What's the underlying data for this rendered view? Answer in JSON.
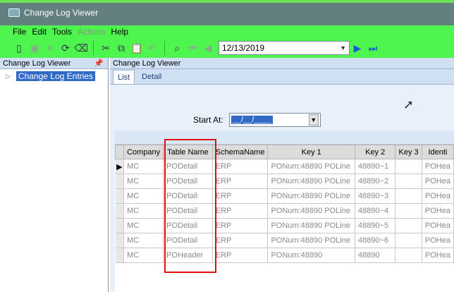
{
  "window": {
    "title": "Change Log Viewer"
  },
  "menu": [
    {
      "label": "File"
    },
    {
      "label": "Edit"
    },
    {
      "label": "Tools"
    },
    {
      "label": "Actions",
      "disabled": true
    },
    {
      "label": "Help"
    }
  ],
  "toolbar": {
    "date_value": "12/13/2019"
  },
  "left_pane": {
    "header": "Change Log Viewer",
    "pin_icon": "pin-icon",
    "tree_item": "Change Log Entries"
  },
  "right_pane": {
    "header": "Change Log Viewer",
    "tabs": [
      {
        "label": "List"
      },
      {
        "label": "Detail"
      }
    ],
    "start_at_label": "Start At:",
    "start_at_value": "__/__/____"
  },
  "grid": {
    "columns": [
      "Company",
      "Table Name",
      "SchemaName",
      "Key 1",
      "Key 2",
      "Key 3",
      "Identi"
    ],
    "rows": [
      [
        "MC",
        "PODetail",
        "ERP",
        "PONum:48890 POLine",
        "48890~1",
        "",
        "POHea"
      ],
      [
        "MC",
        "PODetail",
        "ERP",
        "PONum:48890 POLine",
        "48890~2",
        "",
        "POHea"
      ],
      [
        "MC",
        "PODetail",
        "ERP",
        "PONum:48890 POLine",
        "48890~3",
        "",
        "POHea"
      ],
      [
        "MC",
        "PODetail",
        "ERP",
        "PONum:48890 POLine",
        "48890~4",
        "",
        "POHea"
      ],
      [
        "MC",
        "PODetail",
        "ERP",
        "PONum:48890 POLine",
        "48890~5",
        "",
        "POHea"
      ],
      [
        "MC",
        "PODetail",
        "ERP",
        "PONum:48890 POLine",
        "48890~6",
        "",
        "POHea"
      ],
      [
        "MC",
        "POHeader",
        "ERP",
        "PONum:48890",
        "48890",
        "",
        "POHea"
      ]
    ]
  }
}
